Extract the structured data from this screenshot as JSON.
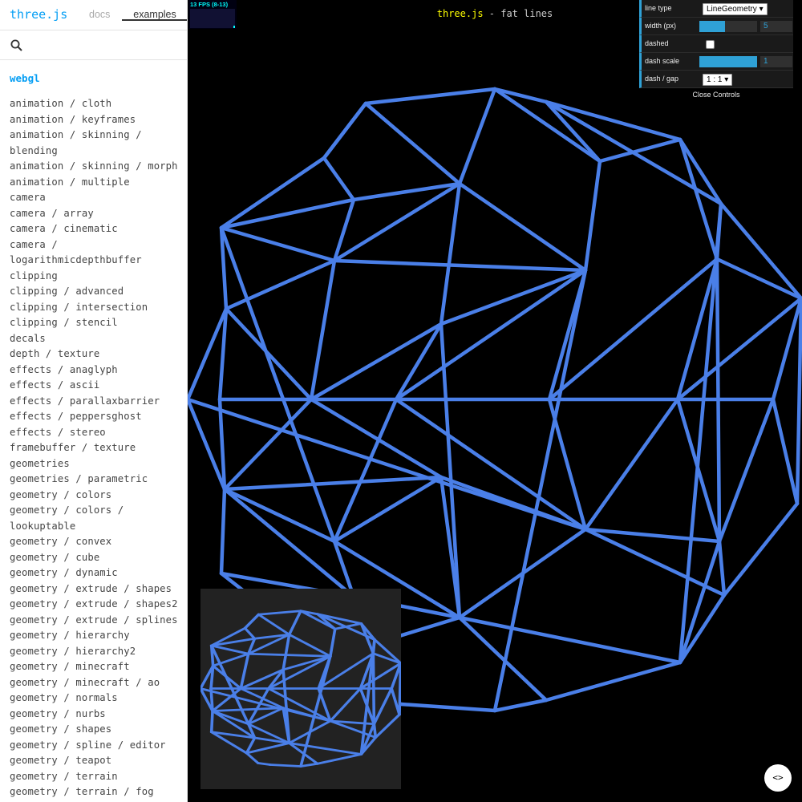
{
  "sidebar": {
    "brand": "three.js",
    "tabs": {
      "docs": "docs",
      "examples": "examples"
    },
    "search": {
      "placeholder": "",
      "value": ""
    },
    "category": "webgl",
    "items": [
      "animation / cloth",
      "animation / keyframes",
      "animation / skinning / blending",
      "animation / skinning / morph",
      "animation / multiple",
      "camera",
      "camera / array",
      "camera / cinematic",
      "camera / logarithmicdepthbuffer",
      "clipping",
      "clipping / advanced",
      "clipping / intersection",
      "clipping / stencil",
      "decals",
      "depth / texture",
      "effects / anaglyph",
      "effects / ascii",
      "effects / parallaxbarrier",
      "effects / peppersghost",
      "effects / stereo",
      "framebuffer / texture",
      "geometries",
      "geometries / parametric",
      "geometry / colors",
      "geometry / colors / lookuptable",
      "geometry / convex",
      "geometry / cube",
      "geometry / dynamic",
      "geometry / extrude / shapes",
      "geometry / extrude / shapes2",
      "geometry / extrude / splines",
      "geometry / hierarchy",
      "geometry / hierarchy2",
      "geometry / minecraft",
      "geometry / minecraft / ao",
      "geometry / normals",
      "geometry / nurbs",
      "geometry / shapes",
      "geometry / spline / editor",
      "geometry / teapot",
      "geometry / terrain",
      "geometry / terrain / fog"
    ]
  },
  "info": {
    "link": "three.js",
    "text": " - fat lines"
  },
  "stats": {
    "label": "13 FPS (8-13)"
  },
  "gui": {
    "line_type": {
      "label": "line type",
      "value": "LineGeometry"
    },
    "width": {
      "label": "width (px)",
      "value": "5",
      "fraction": 0.45
    },
    "dashed": {
      "label": "dashed",
      "checked": false
    },
    "dash_scale": {
      "label": "dash scale",
      "value": "1",
      "fraction": 1.0
    },
    "dash_gap": {
      "label": "dash / gap",
      "value": "1 : 1"
    },
    "close_label": "Close Controls"
  },
  "code_button_label": "<>",
  "colors": {
    "line": "#4a7fe8",
    "accent": "#049ef4",
    "gui_accent": "#2fa1d6"
  },
  "icons": [
    "search-icon",
    "code-icon"
  ]
}
